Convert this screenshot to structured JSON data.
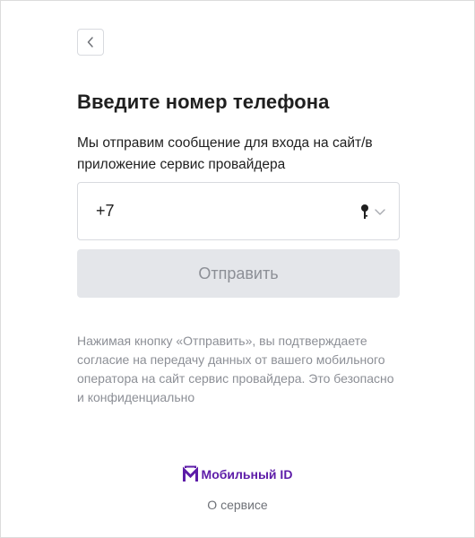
{
  "header": {
    "back_icon": "chevron-left-icon"
  },
  "main": {
    "title": "Введите номер телефона",
    "subtitle": "Мы отправим сообщение для входа на сайт/в приложение сервис провайдера",
    "phone_field": {
      "value": "+7",
      "key_icon": "key-icon",
      "dropdown_icon": "chevron-down-icon"
    },
    "submit_label": "Отправить",
    "disclaimer": "Нажимая кнопку «Отправить», вы подтверждаете согласие на передачу данных от вашего мобильного оператора на сайт сервис провайдера. Это безопасно и конфиденциально"
  },
  "footer": {
    "brand_label": "Мобильный ID",
    "brand_icon": "mobile-id-logo-icon",
    "about_label": "О сервисе"
  },
  "colors": {
    "brand": "#5d1ca8",
    "button_disabled_bg": "#e4e6ea",
    "button_disabled_text": "#8c8f96",
    "border": "#d8dadf"
  }
}
